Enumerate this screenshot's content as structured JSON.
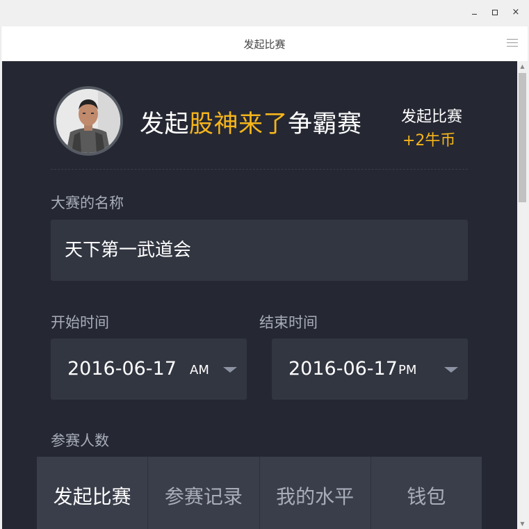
{
  "window": {
    "minimize_icon": "minimize-icon",
    "maximize_icon": "maximize-icon",
    "close_icon": "close-icon",
    "close_glyph": "×"
  },
  "navbar": {
    "title": "发起比赛",
    "menu_icon": "hamburger-menu-icon"
  },
  "header": {
    "headline_prefix": "发起",
    "headline_highlight": "股神来了",
    "headline_suffix": "争霸赛",
    "reward_label": "发起比赛",
    "reward_amount": "+2牛币",
    "highlight_color": "#f6b51b"
  },
  "form": {
    "name_label": "大赛的名称",
    "name_value": "天下第一武道会",
    "start_label": "开始时间",
    "start_date": "2016-06-17",
    "start_period": "AM",
    "end_label": "结束时间",
    "end_date": "2016-06-17",
    "end_period": "PM",
    "participants_label": "参赛人数"
  },
  "tabs": [
    {
      "label": "发起比赛",
      "active": true
    },
    {
      "label": "参赛记录",
      "active": false
    },
    {
      "label": "我的水平",
      "active": false
    },
    {
      "label": "钱包",
      "active": false
    }
  ],
  "colors": {
    "background": "#252833",
    "field": "#323641",
    "tabbar": "#3a3e4a",
    "accent": "#f6b51b"
  }
}
